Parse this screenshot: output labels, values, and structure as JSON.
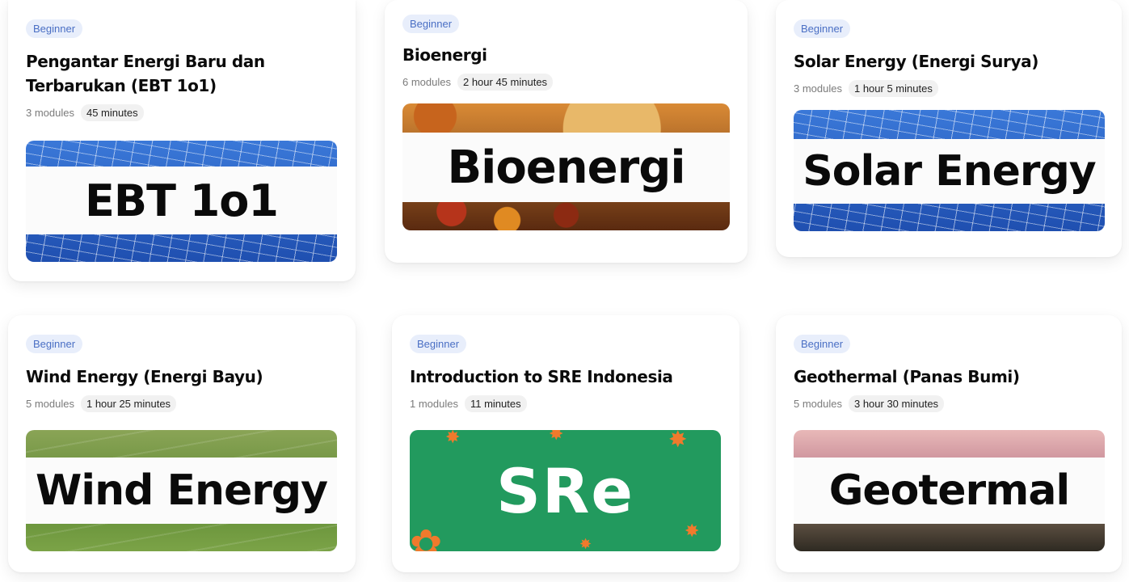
{
  "cards": [
    {
      "badge": "Beginner",
      "title_line1": "Pengantar Energi Baru dan",
      "title_line2": "Terbarukan (EBT 1o1)",
      "modules": "3 modules",
      "duration": "45 minutes",
      "thumb_text": "EBT 1o1"
    },
    {
      "badge": "Beginner",
      "title": "Bioenergi",
      "modules": "6 modules",
      "duration": "2 hour 45 minutes",
      "thumb_text": "Bioenergi"
    },
    {
      "badge": "Beginner",
      "title": "Solar Energy (Energi Surya)",
      "modules": "3 modules",
      "duration": "1 hour 5 minutes",
      "thumb_text": "Solar Energy"
    },
    {
      "badge": "Beginner",
      "title": "Wind Energy (Energi Bayu)",
      "modules": "5 modules",
      "duration": "1 hour 25 minutes",
      "thumb_text": "Wind Energy"
    },
    {
      "badge": "Beginner",
      "title": "Introduction to SRE Indonesia",
      "modules": "1 modules",
      "duration": "11 minutes",
      "thumb_text": "SRe"
    },
    {
      "badge": "Beginner",
      "title": "Geothermal (Panas Bumi)",
      "modules": "5 modules",
      "duration": "3 hour 30 minutes",
      "thumb_text": "Geotermal"
    }
  ],
  "colors": {
    "badge_bg": "#e8eefb",
    "badge_text": "#4a6fc4",
    "sre_green": "#229a5e",
    "sre_orange": "#f07a2c"
  },
  "icons": [
    "sre-star-icon"
  ]
}
